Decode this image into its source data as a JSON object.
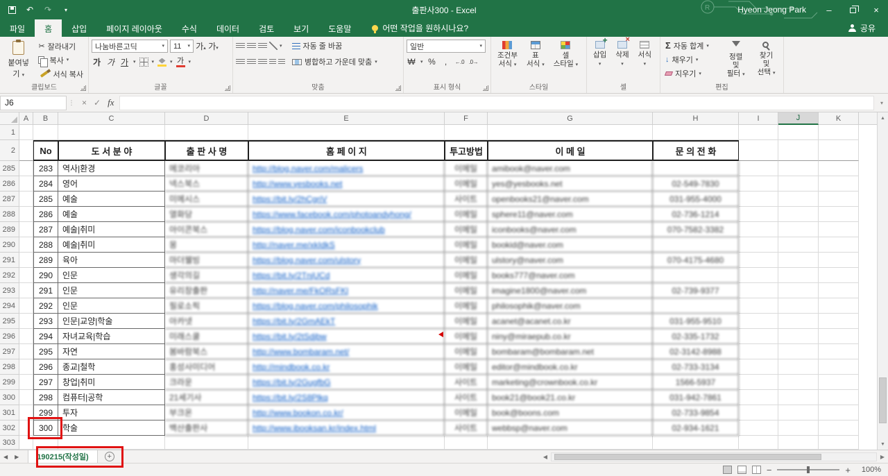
{
  "colors": {
    "excel_green": "#217346",
    "hyperlink_blue": "#0b5bc5",
    "annotation_red": "#e01212"
  },
  "titlebar": {
    "title": "출판사300 - Excel",
    "user": "Hyeon Jeong Park"
  },
  "quick_access": {
    "save_icon": "floppy-disk",
    "undo_icon": "undo-arrow",
    "redo_icon": "redo-arrow",
    "customize_icon": "chevron-down"
  },
  "ribbon_tabs": {
    "file": "파일",
    "items": [
      "홈",
      "삽입",
      "페이지 레이아웃",
      "수식",
      "데이터",
      "검토",
      "보기",
      "도움말"
    ],
    "tell_me": "어떤 작업을 원하시나요?",
    "tell_me_icon": "lightbulb",
    "share": "공유",
    "share_icon": "person"
  },
  "ribbon": {
    "clipboard": {
      "label": "클립보드",
      "paste": "붙여넣기",
      "cut": "잘라내기",
      "copy": "복사",
      "format_painter": "서식 복사",
      "paste_icon": "clipboard",
      "cut_icon": "scissors",
      "copy_icon": "two-pages",
      "painter_icon": "brush"
    },
    "font": {
      "label": "글꼴",
      "name": "나눔바른고딕",
      "size": "11",
      "bold": "가",
      "italic": "가",
      "underline": "가",
      "grow": "가",
      "shrink": "가"
    },
    "align": {
      "label": "맞춤",
      "wrap": "자동 줄 바꿈",
      "merge": "병합하고 가운데 맞춤"
    },
    "number": {
      "label": "표시 형식",
      "format": "일반",
      "accounting": "₩",
      "percent": "%",
      "comma": ",",
      "inc_decimal": "←.0",
      "dec_decimal": ".0→"
    },
    "styles": {
      "label": "스타일",
      "conditional": [
        "조건부",
        "서식"
      ],
      "table": [
        "표",
        "서식"
      ],
      "cell": [
        "셀",
        "스타일"
      ]
    },
    "cells": {
      "label": "셀",
      "insert": "삽입",
      "del": "삭제",
      "format": "서식"
    },
    "editing": {
      "label": "편집",
      "autosum": "자동 합계",
      "fill": "채우기",
      "clear": "지우기",
      "sort": [
        "정렬 및",
        "필터"
      ],
      "find": [
        "찾기 및",
        "선택"
      ],
      "autosum_icon": "sigma",
      "sort_icon": "funnel",
      "find_icon": "magnifier"
    }
  },
  "formula_bar": {
    "name_box": "J6",
    "fx": "fx"
  },
  "grid": {
    "columns": [
      "A",
      "B",
      "C",
      "D",
      "E",
      "F",
      "G",
      "H",
      "I",
      "J",
      "K"
    ],
    "selected_column": "J",
    "row1_label": "1",
    "row2_label": "2",
    "partial_row_label": "303",
    "header_row": {
      "no": "No",
      "category": "도 서 분 야",
      "publisher": "출 판 사 명",
      "homepage": "홈 페 이 지",
      "method": "투고방법",
      "email": "이 메 일",
      "phone": "문 의 전 화"
    },
    "rows": [
      {
        "row": "285",
        "no": "283",
        "category": "역사|환경",
        "publisher": "메코리아",
        "url": "http://blog.naver.com/malicers",
        "method": "이메일",
        "email": "amibook@naver.com",
        "phone": ""
      },
      {
        "row": "286",
        "no": "284",
        "category": "영어",
        "publisher": "넥스북스",
        "url": "http://www.yesbooks.net",
        "method": "이메일",
        "email": "yes@yesbooks.net",
        "phone": "02-549-7830"
      },
      {
        "row": "287",
        "no": "285",
        "category": "예술",
        "publisher": "미메시스",
        "url": "https://bit.ly/2hCgriV",
        "method": "사이트",
        "email": "openbooks21@naver.com",
        "phone": "031-955-4000"
      },
      {
        "row": "288",
        "no": "286",
        "category": "예술",
        "publisher": "열화당",
        "url": "https://www.facebook.com/photoandyhong/",
        "method": "이메일",
        "email": "sphere11@naver.com",
        "phone": "02-736-1214"
      },
      {
        "row": "289",
        "no": "287",
        "category": "예술|취미",
        "publisher": "아이콘북스",
        "url": "https://blog.naver.com/iconbookclub",
        "method": "이메일",
        "email": "iconbooks@naver.com",
        "phone": "070-7582-3382"
      },
      {
        "row": "290",
        "no": "288",
        "category": "예술|취미",
        "publisher": "몽",
        "url": "http://naver.me/xkIdkS",
        "method": "이메일",
        "email": "bookid@naver.com",
        "phone": ""
      },
      {
        "row": "291",
        "no": "289",
        "category": "육아",
        "publisher": "마더웰빙",
        "url": "https://blog.naver.com/ulstory",
        "method": "이메일",
        "email": "ulstory@naver.com",
        "phone": "070-4175-4680"
      },
      {
        "row": "292",
        "no": "290",
        "category": "인문",
        "publisher": "생각의길",
        "url": "https://bit.ly/2TnjUCd",
        "method": "이메일",
        "email": "books777@naver.com",
        "phone": ""
      },
      {
        "row": "293",
        "no": "291",
        "category": "인문",
        "publisher": "유리창출판",
        "url": "http://naver.me/FkORsFKl",
        "method": "이메일",
        "email": "imagine1800@naver.com",
        "phone": "02-739-9377"
      },
      {
        "row": "294",
        "no": "292",
        "category": "인문",
        "publisher": "필로소픽",
        "url": "https://blog.naver.com/philosophik",
        "method": "이메일",
        "email": "philosophik@naver.com",
        "phone": ""
      },
      {
        "row": "295",
        "no": "293",
        "category": "인문|교양|학술",
        "publisher": "아카넷",
        "url": "https://bit.ly/2GmAEkT",
        "method": "이메일",
        "email": "acanet@acanet.co.kr",
        "phone": "031-955-9510"
      },
      {
        "row": "296",
        "no": "294",
        "category": "자녀교육|학습",
        "publisher": "미래스쿨",
        "url": "https://bit.ly/2tSdjbw",
        "method": "이메일",
        "email": "niny@miraepub.co.kr",
        "phone": "02-335-1732",
        "comment": true
      },
      {
        "row": "297",
        "no": "295",
        "category": "자연",
        "publisher": "봄바람북스",
        "url": "http://www.bombaram.net/",
        "method": "이메일",
        "email": "bombaram@bombaram.net",
        "phone": "02-3142-8988"
      },
      {
        "row": "298",
        "no": "296",
        "category": "종교|철학",
        "publisher": "홍성사미디어",
        "url": "http://mindbook.co.kr",
        "method": "이메일",
        "email": "editor@mindbook.co.kr",
        "phone": "02-733-3134"
      },
      {
        "row": "299",
        "no": "297",
        "category": "창업|취미",
        "publisher": "크라운",
        "url": "https://bit.ly/2GugfbG",
        "method": "사이트",
        "email": "marketing@crownbook.co.kr",
        "phone": "1566-5937"
      },
      {
        "row": "300",
        "no": "298",
        "category": "컴퓨터|공학",
        "publisher": "21세기사",
        "url": "https://bit.ly/2S8Plkq",
        "method": "사이트",
        "email": "book21@book21.co.kr",
        "phone": "031-942-7861"
      },
      {
        "row": "301",
        "no": "299",
        "category": "투자",
        "publisher": "부크온",
        "url": "http://www.bookon.co.kr/",
        "method": "이메일",
        "email": "book@boons.com",
        "phone": "02-733-9854"
      },
      {
        "row": "302",
        "no": "300",
        "category": "학술",
        "publisher": "백산출판사",
        "url": "http://www.ibooksan.kr/index.html",
        "method": "사이트",
        "email": "webbsp@naver.com",
        "phone": "02-934-1621",
        "highlight": true
      }
    ]
  },
  "sheet_bar": {
    "tab": "190215(작성일)",
    "add_sheet_icon": "plus-circle"
  },
  "status_bar": {
    "zoom": "100%",
    "view_icons": [
      "normal-view",
      "page-layout-view",
      "page-break-view"
    ]
  }
}
